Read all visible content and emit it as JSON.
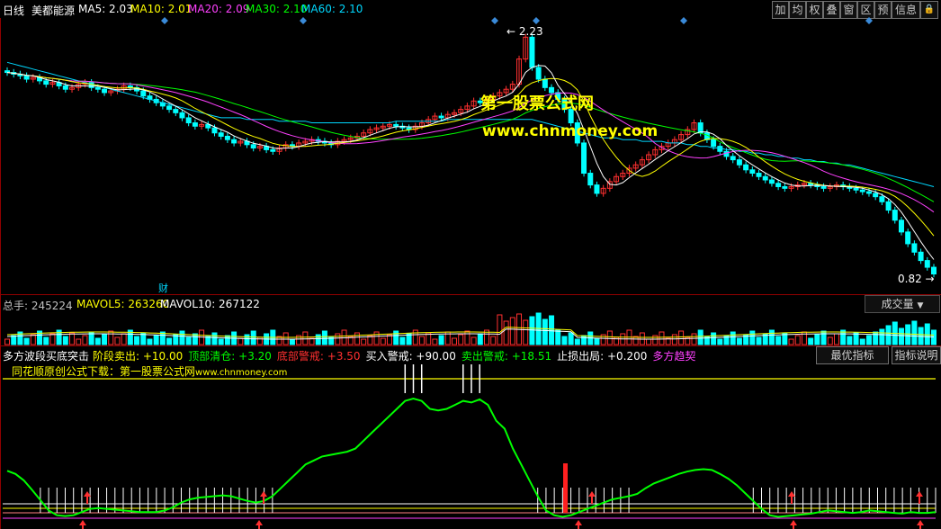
{
  "header": {
    "period": "日线",
    "stock_name": "美都能源",
    "ma5": "MA5: 2.03",
    "ma10": "MA10: 2.01",
    "ma20": "MA20: 2.09",
    "ma30": "MA30: 2.10",
    "ma60": "MA60: 2.10",
    "toolbar": [
      "加",
      "均",
      "权",
      "叠",
      "窗",
      "区",
      "预",
      "信息",
      "🔒"
    ]
  },
  "main_chart": {
    "high_label": "2.23",
    "low_label": "0.82",
    "cai_label": "财",
    "watermark_title": "第一股票公式网",
    "watermark_url": "www.chnmoney.com"
  },
  "volume_pane": {
    "total": "总手: 245224",
    "mavol5": "MAVOL5: 263260",
    "mavol10": "MAVOL10: 267122",
    "dropdown": "成交量"
  },
  "indicator_pane": {
    "name": "多方波段买底突击",
    "params": [
      {
        "label": "阶段卖出: +10.00",
        "color": "#ffff00"
      },
      {
        "label": "顶部清仓: +3.20",
        "color": "#00ff00"
      },
      {
        "label": "底部警戒: +3.50",
        "color": "#ff3030"
      },
      {
        "label": "买入警戒: +90.00",
        "color": "#ffffff"
      },
      {
        "label": "卖出警戒: +18.51",
        "color": "#00ff00"
      },
      {
        "label": "止损出局: +0.200",
        "color": "#ffffff"
      },
      {
        "label": "多方趋契",
        "color": "#ff40ff"
      }
    ],
    "best_button": "最优指标",
    "help_button": "指标说明",
    "download_note": "同花顺原创公式下载：第一股票公式网",
    "download_url": "www.chnmoney.com"
  },
  "colors": {
    "ma5": "#ffffff",
    "ma10": "#ffff00",
    "ma20": "#ff40ff",
    "ma30": "#00ff00",
    "ma60": "#00d8ff",
    "up": "#ff3030",
    "down": "#00ffff"
  },
  "chart_data": {
    "type": "line",
    "title": "",
    "candles_close": [
      2.02,
      2.01,
      2.0,
      1.98,
      1.99,
      1.97,
      1.95,
      1.96,
      1.94,
      1.92,
      1.93,
      1.95,
      1.96,
      1.93,
      1.92,
      1.9,
      1.91,
      1.92,
      1.94,
      1.93,
      1.91,
      1.88,
      1.86,
      1.84,
      1.82,
      1.8,
      1.78,
      1.75,
      1.72,
      1.7,
      1.71,
      1.69,
      1.66,
      1.64,
      1.62,
      1.6,
      1.61,
      1.59,
      1.57,
      1.58,
      1.56,
      1.55,
      1.57,
      1.59,
      1.58,
      1.6,
      1.61,
      1.62,
      1.61,
      1.6,
      1.59,
      1.61,
      1.62,
      1.63,
      1.64,
      1.66,
      1.68,
      1.69,
      1.7,
      1.71,
      1.7,
      1.69,
      1.68,
      1.7,
      1.72,
      1.74,
      1.76,
      1.75,
      1.77,
      1.78,
      1.8,
      1.82,
      1.85,
      1.84,
      1.86,
      1.88,
      1.9,
      1.92,
      1.95,
      2.1,
      2.23,
      2.05,
      1.98,
      1.93,
      1.9,
      1.86,
      1.8,
      1.72,
      1.6,
      1.42,
      1.35,
      1.3,
      1.33,
      1.37,
      1.4,
      1.42,
      1.45,
      1.47,
      1.5,
      1.53,
      1.56,
      1.58,
      1.6,
      1.62,
      1.65,
      1.68,
      1.72,
      1.66,
      1.62,
      1.58,
      1.55,
      1.52,
      1.5,
      1.47,
      1.44,
      1.42,
      1.4,
      1.38,
      1.36,
      1.34,
      1.33,
      1.34,
      1.35,
      1.36,
      1.35,
      1.34,
      1.33,
      1.34,
      1.35,
      1.34,
      1.33,
      1.32,
      1.31,
      1.3,
      1.28,
      1.25,
      1.2,
      1.14,
      1.07,
      1.0,
      0.95,
      0.9,
      0.86,
      0.82
    ],
    "ma60": [
      2.08,
      2.07,
      2.06,
      2.05,
      2.04,
      2.03,
      2.02,
      2.01,
      2.0,
      1.99,
      1.98,
      1.97,
      1.96,
      1.95,
      1.94,
      1.93,
      1.92,
      1.91,
      1.9,
      1.89,
      1.88,
      1.87,
      1.86,
      1.85,
      1.84,
      1.83,
      1.82,
      1.81,
      1.8,
      1.79,
      1.78,
      1.77,
      1.76,
      1.75,
      1.75,
      1.75,
      1.75,
      1.74,
      1.74,
      1.74,
      1.74,
      1.74,
      1.73,
      1.73,
      1.73,
      1.73,
      1.73,
      1.72,
      1.72,
      1.72,
      1.72,
      1.72,
      1.72,
      1.72,
      1.72,
      1.72,
      1.72,
      1.72,
      1.72,
      1.72,
      1.73,
      1.73,
      1.73,
      1.73,
      1.73,
      1.73,
      1.73,
      1.73,
      1.74,
      1.74,
      1.74,
      1.74,
      1.74,
      1.74,
      1.74,
      1.74,
      1.74,
      1.74,
      1.74,
      1.74,
      1.74,
      1.74,
      1.73,
      1.72,
      1.71,
      1.7,
      1.69,
      1.68,
      1.67,
      1.66,
      1.65,
      1.64,
      1.63,
      1.63,
      1.63,
      1.62,
      1.62,
      1.62,
      1.61,
      1.61,
      1.61,
      1.61,
      1.6,
      1.6,
      1.6,
      1.59,
      1.59,
      1.58,
      1.58,
      1.57,
      1.57,
      1.56,
      1.56,
      1.55,
      1.55,
      1.54,
      1.54,
      1.53,
      1.53,
      1.52,
      1.52,
      1.51,
      1.51,
      1.5,
      1.5,
      1.49,
      1.49,
      1.48,
      1.48,
      1.47,
      1.47,
      1.46,
      1.45,
      1.44,
      1.43,
      1.42,
      1.41,
      1.4,
      1.39,
      1.38,
      1.37,
      1.36,
      1.35,
      1.34
    ],
    "indicator": [
      62,
      58,
      50,
      38,
      25,
      12,
      6,
      5,
      6,
      10,
      14,
      15,
      14,
      13,
      12,
      11,
      10,
      10,
      10,
      12,
      16,
      22,
      26,
      28,
      29,
      30,
      31,
      30,
      27,
      24,
      22,
      24,
      30,
      40,
      50,
      60,
      70,
      75,
      80,
      82,
      84,
      86,
      90,
      100,
      110,
      120,
      130,
      140,
      150,
      153,
      150,
      140,
      138,
      140,
      145,
      150,
      148,
      152,
      145,
      125,
      115,
      90,
      70,
      50,
      30,
      12,
      6,
      4,
      6,
      10,
      14,
      18,
      22,
      26,
      28,
      30,
      33,
      40,
      46,
      50,
      54,
      58,
      61,
      63,
      64,
      63,
      58,
      52,
      44,
      34,
      24,
      14,
      6,
      4,
      5,
      6,
      7,
      8,
      10,
      12,
      11,
      10,
      9,
      10,
      12,
      11,
      10,
      9,
      8,
      10,
      9,
      9,
      10
    ],
    "indicator_range": [
      0,
      170
    ]
  }
}
